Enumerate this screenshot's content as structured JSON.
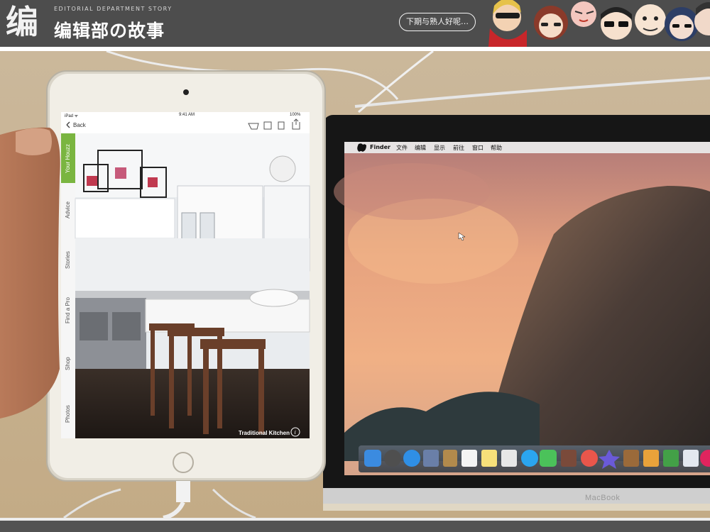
{
  "banner": {
    "logo_glyph": "编",
    "tagline_en": "EDITORIAL DEPARTMENT STORY",
    "title_cn": "编辑部の故事",
    "speech_note": "下期与熟人好呢…"
  },
  "ipad": {
    "status_carrier": "iPad ᯤ",
    "status_time": "9:41 AM",
    "status_battery": "100%",
    "back_label": "Back",
    "tabs": [
      "Your Houzz",
      "Advice",
      "Stories",
      "Find a Pro",
      "Shop",
      "Photos"
    ],
    "active_tab": "Your Houzz",
    "photo_caption": "Traditional Kitchen",
    "accent_color": "#7ab540"
  },
  "mac": {
    "menu_items": [
      "Finder",
      "文件",
      "编辑",
      "显示",
      "前往",
      "窗口",
      "帮助"
    ],
    "device_label": "MacBook"
  }
}
